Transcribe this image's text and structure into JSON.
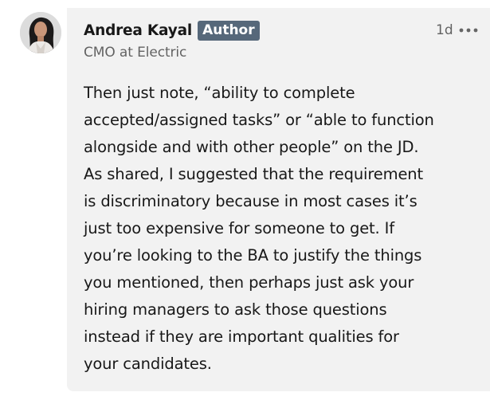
{
  "comment": {
    "author": "Andrea Kayal",
    "badge": "Author",
    "headline": "CMO at Electric",
    "timestamp": "1d",
    "more_icon": "ellipsis-horizontal-icon",
    "avatar_icon": "profile-photo",
    "text": "Then just note, “ability to complete\naccepted/assigned tasks” or “able to function\nalongside and with other people” on the JD.\nAs shared, I suggested that the requirement\nis discriminatory because in most cases it’s\njust too expensive for someone to get. If\nyou’re looking to the BA to justify the things\nyou mentioned, then perhaps just ask your\nhiring managers to ask those questions\ninstead if they are important qualities for\nyour candidates."
  },
  "colors": {
    "bubble_bg": "#f2f2f2",
    "badge_bg": "#56687a",
    "secondary_text": "#666666",
    "primary_text": "#191919"
  }
}
